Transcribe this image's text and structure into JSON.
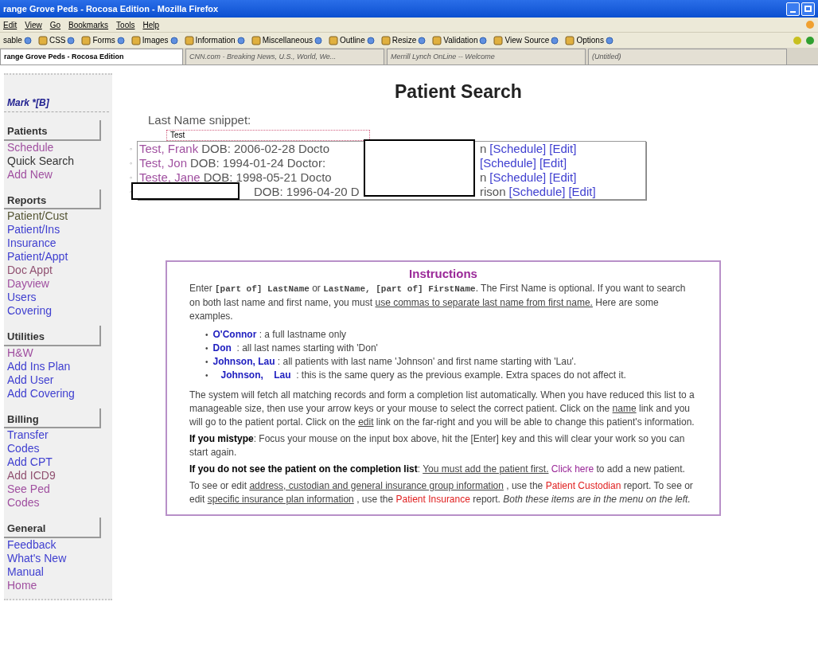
{
  "window": {
    "title": "range Grove Peds - Rocosa Edition - Mozilla Firefox"
  },
  "menu": [
    "Edit",
    "View",
    "Go",
    "Bookmarks",
    "Tools",
    "Help"
  ],
  "toolbar": [
    "sable",
    "CSS",
    "Forms",
    "Images",
    "Information",
    "Miscellaneous",
    "Outline",
    "Resize",
    "Validation",
    "View Source",
    "Options"
  ],
  "tabs": [
    {
      "label": "range Grove Peds - Rocosa Edition",
      "selected": true
    },
    {
      "label": "CNN.com - Breaking News, U.S., World, We...",
      "selected": false
    },
    {
      "label": "Merrill Lynch OnLine -- Welcome",
      "selected": false
    },
    {
      "label": "(Untitled)",
      "selected": false
    }
  ],
  "sidebar": {
    "user": "Mark *[B]",
    "sections": [
      {
        "title": "Patients",
        "items": [
          {
            "label": "Schedule",
            "color": "#a050a0"
          },
          {
            "label": "Quick Search",
            "color": "#333333"
          },
          {
            "label": "Add New",
            "color": "#a050a0"
          }
        ]
      },
      {
        "title": "Reports",
        "items": [
          {
            "label": "Patient/Cust",
            "color": "#555533"
          },
          {
            "label": "Patient/Ins",
            "color": "#4040d0"
          },
          {
            "label": "Insurance",
            "color": "#4040d0"
          },
          {
            "label": "Patient/Appt",
            "color": "#4040d0"
          },
          {
            "label": "Doc Appt",
            "color": "#905070"
          },
          {
            "label": "Dayview",
            "color": "#a050a0"
          },
          {
            "label": "Users",
            "color": "#4040d0"
          },
          {
            "label": "Covering",
            "color": "#4040d0"
          }
        ]
      },
      {
        "title": "Utilities",
        "items": [
          {
            "label": "H&W",
            "color": "#a050a0"
          },
          {
            "label": "Add Ins Plan",
            "color": "#4040d0"
          },
          {
            "label": "Add User",
            "color": "#4040d0"
          },
          {
            "label": "Add Covering",
            "color": "#4040d0"
          }
        ]
      },
      {
        "title": "Billing",
        "items": [
          {
            "label": "Transfer Codes",
            "color": "#4040d0"
          },
          {
            "label": "Add CPT",
            "color": "#4040d0"
          },
          {
            "label": "Add ICD9",
            "color": "#905070"
          },
          {
            "label": "See Ped Codes",
            "color": "#a050a0"
          }
        ]
      },
      {
        "title": "General",
        "items": [
          {
            "label": "Feedback",
            "color": "#4040d0"
          },
          {
            "label": "What's New",
            "color": "#4040d0"
          },
          {
            "label": "Manual",
            "color": "#4040d0"
          },
          {
            "label": "Home",
            "color": "#a050a0"
          }
        ]
      }
    ]
  },
  "heading": "Patient Search",
  "search": {
    "label": "Last Name snippet:",
    "value": "Test"
  },
  "results": [
    {
      "bullet": "◦",
      "name": "Test, Frank",
      "details": "DOB: 2006-02-28 Docto",
      "suffix": "n",
      "schedule": "[Schedule]",
      "edit": "[Edit]"
    },
    {
      "bullet": "◦",
      "name": "Test, Jon",
      "details": "DOB: 1994-01-24 Doctor:",
      "schedule": "[Schedule]",
      "edit": "[Edit]"
    },
    {
      "bullet": "◦",
      "name": "Teste, Jane",
      "details": "DOB: 1998-05-21 Docto",
      "suffix": "n",
      "schedule": "[Schedule]",
      "edit": "[Edit]"
    },
    {
      "bullet": "◦",
      "details": "DOB: 1996-04-20 D",
      "suffix": "rison",
      "schedule": "[Schedule]",
      "edit": "[Edit]"
    }
  ],
  "instructions": {
    "title": "Instructions",
    "intro": [
      {
        "kind": "plain",
        "t": "Enter "
      },
      {
        "kind": "mono",
        "t": "[part of] LastName"
      },
      {
        "kind": "plain",
        "t": " or "
      },
      {
        "kind": "mono",
        "t": "LastName, [part of] FirstName"
      },
      {
        "kind": "plain",
        "t": ". The First Name is optional. If you want to search on both last name and first name, you must "
      },
      {
        "kind": "u",
        "t": "use commas to separate last name from first name."
      },
      {
        "kind": "plain",
        "t": " Here are some examples."
      }
    ],
    "examples": [
      {
        "bullet": "•",
        "term": "O'Connor",
        "desc": ": a full lastname only"
      },
      {
        "bullet": "•",
        "term": "Don ",
        "desc": ": all last names starting with 'Don'"
      },
      {
        "bullet": "•",
        "term": "Johnson, Lau",
        "desc": ": all patients with last name 'Johnson' and first name starting with 'Lau'."
      },
      {
        "bullet": "•",
        "term": "   Johnson,    Lau ",
        "desc": ": this is the same query as the previous example. Extra spaces do not affect it."
      }
    ],
    "paragraphs": [
      [
        {
          "kind": "plain",
          "t": "The system will fetch all matching records and form a completion list automatically. When you have reduced this list to a manageable size, then use your arrow keys or your mouse to select the correct patient. Click on the "
        },
        {
          "kind": "u",
          "t": "name"
        },
        {
          "kind": "plain",
          "t": " link and you will go to the patient portal. Click on the "
        },
        {
          "kind": "u",
          "t": "edit"
        },
        {
          "kind": "plain",
          "t": " link on the far-right and you will be able to change this patient's information."
        }
      ],
      [
        {
          "kind": "b",
          "t": "If you mistype"
        },
        {
          "kind": "plain",
          "t": ": Focus your mouse on the input box above, hit the [Enter] key and this will clear your work so you can start again."
        }
      ],
      [
        {
          "kind": "b",
          "t": "If you do not see the patient on the completion list"
        },
        {
          "kind": "plain",
          "t": ": "
        },
        {
          "kind": "u",
          "t": "You must add the patient first."
        },
        {
          "kind": "visited",
          "t": " Click here"
        },
        {
          "kind": "plain",
          "t": " to add a new patient."
        }
      ],
      [
        {
          "kind": "plain",
          "t": "To see or edit "
        },
        {
          "kind": "u",
          "t": "address, custodian and general insurance group information"
        },
        {
          "kind": "plain",
          "t": " , use the "
        },
        {
          "kind": "red",
          "t": "Patient Custodian"
        },
        {
          "kind": "plain",
          "t": " report. To see or edit "
        },
        {
          "kind": "u",
          "t": "specific insurance plan information"
        },
        {
          "kind": "plain",
          "t": " , use the "
        },
        {
          "kind": "red",
          "t": "Patient Insurance"
        },
        {
          "kind": "plain",
          "t": " report. "
        },
        {
          "kind": "i",
          "t": "Both these items are in the menu on the left."
        }
      ]
    ]
  }
}
